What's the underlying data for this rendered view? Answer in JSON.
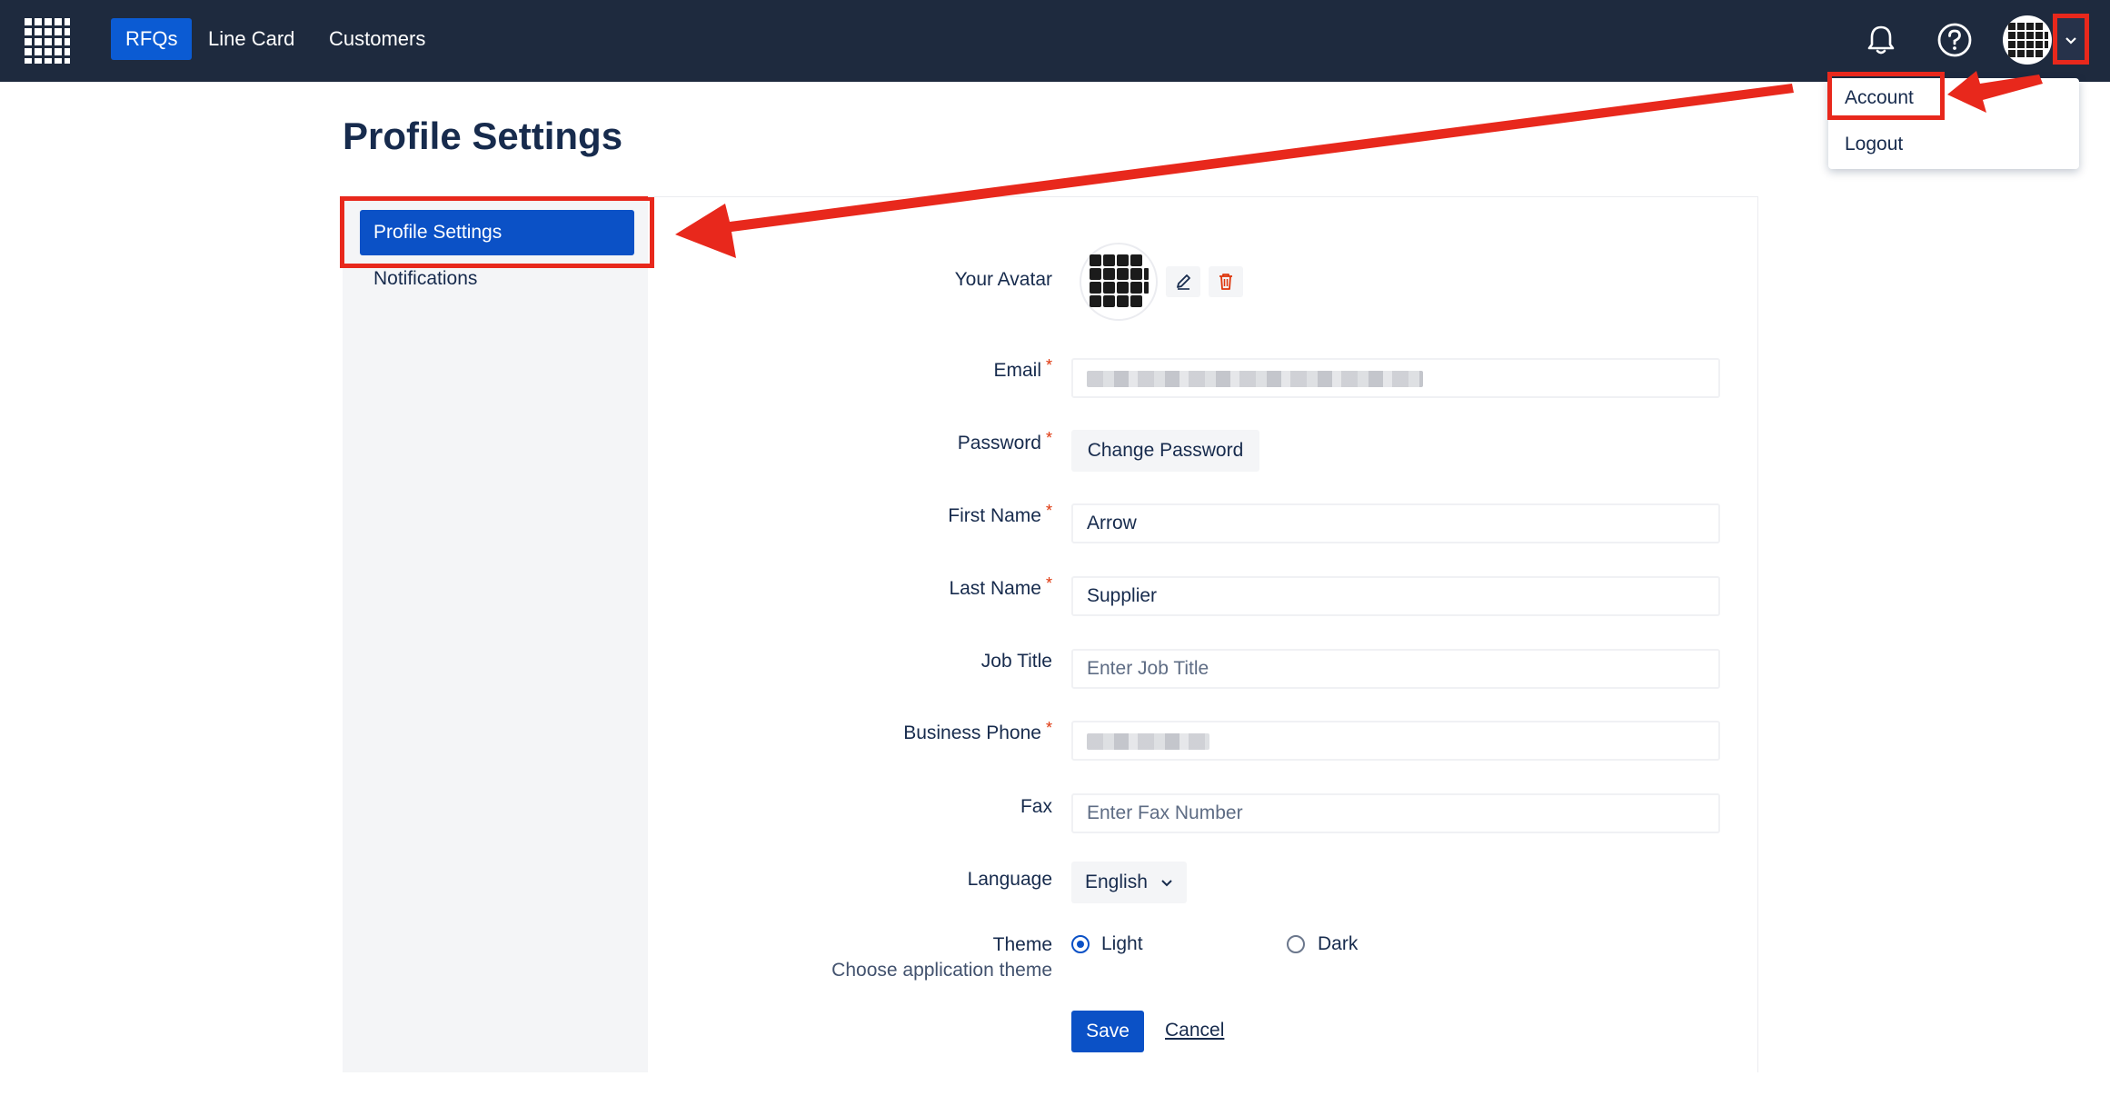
{
  "nav": {
    "items": [
      {
        "label": "RFQs",
        "active": true
      },
      {
        "label": "Line Card",
        "active": false
      },
      {
        "label": "Customers",
        "active": false
      }
    ],
    "icons": [
      "bell-icon",
      "help-icon",
      "user-avatar",
      "chevron-down-icon"
    ]
  },
  "dropdown": {
    "items": [
      "Account",
      "Logout"
    ]
  },
  "page": {
    "title": "Profile Settings"
  },
  "sidebar": {
    "items": [
      {
        "label": "Profile Settings",
        "active": true
      },
      {
        "label": "Notifications",
        "active": false
      }
    ]
  },
  "form": {
    "avatar_label": "Your Avatar",
    "email_label": "Email",
    "password_label": "Password",
    "change_password_label": "Change Password",
    "first_name_label": "First Name",
    "first_name_value": "Arrow",
    "last_name_label": "Last Name",
    "last_name_value": "Supplier",
    "job_title_label": "Job Title",
    "job_title_placeholder": "Enter Job Title",
    "business_phone_label": "Business Phone",
    "fax_label": "Fax",
    "fax_placeholder": "Enter Fax Number",
    "language_label": "Language",
    "language_value": "English",
    "theme_label": "Theme",
    "theme_sublabel": "Choose application theme",
    "theme_options": [
      "Light",
      "Dark"
    ],
    "theme_selected": "Light",
    "required_marker": "*",
    "save_label": "Save",
    "cancel_label": "Cancel"
  },
  "colors": {
    "navbar": "#1e2a3e",
    "primary": "#0b51c6",
    "annotation_red": "#e8281c",
    "required": "#de350b"
  }
}
